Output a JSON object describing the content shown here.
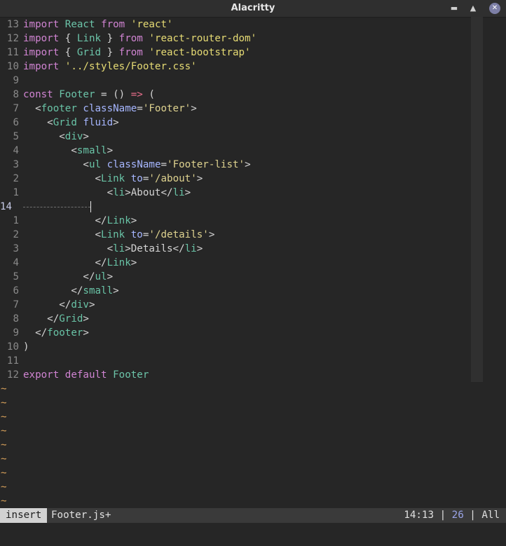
{
  "window": {
    "title": "Alacritty"
  },
  "editor": {
    "lines": [
      {
        "ln": "13",
        "seg": [
          {
            "t": "import",
            "c": "kw"
          },
          {
            "t": " "
          },
          {
            "t": "React",
            "c": "id"
          },
          {
            "t": " "
          },
          {
            "t": "from",
            "c": "kw"
          },
          {
            "t": " "
          },
          {
            "t": "'react'",
            "c": "str"
          }
        ]
      },
      {
        "ln": "12",
        "seg": [
          {
            "t": "import",
            "c": "kw"
          },
          {
            "t": " { "
          },
          {
            "t": "Link",
            "c": "id"
          },
          {
            "t": " } "
          },
          {
            "t": "from",
            "c": "kw"
          },
          {
            "t": " "
          },
          {
            "t": "'react-router-dom'",
            "c": "str"
          }
        ]
      },
      {
        "ln": "11",
        "seg": [
          {
            "t": "import",
            "c": "kw"
          },
          {
            "t": " { "
          },
          {
            "t": "Grid",
            "c": "id"
          },
          {
            "t": " } "
          },
          {
            "t": "from",
            "c": "kw"
          },
          {
            "t": " "
          },
          {
            "t": "'react-bootstrap'",
            "c": "str"
          }
        ]
      },
      {
        "ln": "10",
        "seg": [
          {
            "t": "import",
            "c": "kw"
          },
          {
            "t": " "
          },
          {
            "t": "'../styles/Footer.css'",
            "c": "str"
          }
        ]
      },
      {
        "ln": "9",
        "seg": []
      },
      {
        "ln": "8",
        "seg": [
          {
            "t": "const",
            "c": "kw"
          },
          {
            "t": " "
          },
          {
            "t": "Footer",
            "c": "id"
          },
          {
            "t": " = () "
          },
          {
            "t": "=>",
            "c": "op"
          },
          {
            "t": " ("
          }
        ]
      },
      {
        "ln": "7",
        "seg": [
          {
            "t": "  <"
          },
          {
            "t": "footer",
            "c": "tag"
          },
          {
            "t": " "
          },
          {
            "t": "className",
            "c": "attr"
          },
          {
            "t": "="
          },
          {
            "t": "'Footer'",
            "c": "str2"
          },
          {
            "t": ">"
          }
        ]
      },
      {
        "ln": "6",
        "seg": [
          {
            "t": "    <"
          },
          {
            "t": "Grid",
            "c": "tag"
          },
          {
            "t": " "
          },
          {
            "t": "fluid",
            "c": "attr"
          },
          {
            "t": ">"
          }
        ]
      },
      {
        "ln": "5",
        "seg": [
          {
            "t": "      <"
          },
          {
            "t": "div",
            "c": "tag"
          },
          {
            "t": ">"
          }
        ]
      },
      {
        "ln": "4",
        "seg": [
          {
            "t": "        <"
          },
          {
            "t": "small",
            "c": "tag"
          },
          {
            "t": ">"
          }
        ]
      },
      {
        "ln": "3",
        "seg": [
          {
            "t": "          <"
          },
          {
            "t": "ul",
            "c": "tag"
          },
          {
            "t": " "
          },
          {
            "t": "className",
            "c": "attr"
          },
          {
            "t": "="
          },
          {
            "t": "'Footer-list'",
            "c": "str2"
          },
          {
            "t": ">"
          }
        ]
      },
      {
        "ln": "2",
        "seg": [
          {
            "t": "            <"
          },
          {
            "t": "Link",
            "c": "tag"
          },
          {
            "t": " "
          },
          {
            "t": "to",
            "c": "attr"
          },
          {
            "t": "="
          },
          {
            "t": "'/about'",
            "c": "str2"
          },
          {
            "t": ">"
          }
        ]
      },
      {
        "ln": "1",
        "seg": [
          {
            "t": "              <"
          },
          {
            "t": "li",
            "c": "tag"
          },
          {
            "t": ">About</"
          },
          {
            "t": "li",
            "c": "tag"
          },
          {
            "t": ">"
          }
        ]
      },
      {
        "ln": "14",
        "current": true,
        "seg": []
      },
      {
        "ln": "1",
        "seg": [
          {
            "t": "            </"
          },
          {
            "t": "Link",
            "c": "tag"
          },
          {
            "t": ">"
          }
        ]
      },
      {
        "ln": "2",
        "seg": [
          {
            "t": "            <"
          },
          {
            "t": "Link",
            "c": "tag"
          },
          {
            "t": " "
          },
          {
            "t": "to",
            "c": "attr"
          },
          {
            "t": "="
          },
          {
            "t": "'/details'",
            "c": "str2"
          },
          {
            "t": ">"
          }
        ]
      },
      {
        "ln": "3",
        "seg": [
          {
            "t": "              <"
          },
          {
            "t": "li",
            "c": "tag"
          },
          {
            "t": ">Details</"
          },
          {
            "t": "li",
            "c": "tag"
          },
          {
            "t": ">"
          }
        ]
      },
      {
        "ln": "4",
        "seg": [
          {
            "t": "            </"
          },
          {
            "t": "Link",
            "c": "tag"
          },
          {
            "t": ">"
          }
        ]
      },
      {
        "ln": "5",
        "seg": [
          {
            "t": "          </"
          },
          {
            "t": "ul",
            "c": "tag"
          },
          {
            "t": ">"
          }
        ]
      },
      {
        "ln": "6",
        "seg": [
          {
            "t": "        </"
          },
          {
            "t": "small",
            "c": "tag"
          },
          {
            "t": ">"
          }
        ]
      },
      {
        "ln": "7",
        "seg": [
          {
            "t": "      </"
          },
          {
            "t": "div",
            "c": "tag"
          },
          {
            "t": ">"
          }
        ]
      },
      {
        "ln": "8",
        "seg": [
          {
            "t": "    </"
          },
          {
            "t": "Grid",
            "c": "tag"
          },
          {
            "t": ">"
          }
        ]
      },
      {
        "ln": "9",
        "seg": [
          {
            "t": "  </"
          },
          {
            "t": "footer",
            "c": "tag"
          },
          {
            "t": ">"
          }
        ]
      },
      {
        "ln": "10",
        "seg": [
          {
            "t": ")"
          }
        ]
      },
      {
        "ln": "11",
        "seg": []
      },
      {
        "ln": "12",
        "seg": [
          {
            "t": "export",
            "c": "kw"
          },
          {
            "t": " "
          },
          {
            "t": "default",
            "c": "kw"
          },
          {
            "t": " "
          },
          {
            "t": "Footer",
            "c": "id"
          }
        ]
      }
    ],
    "empty_line_marker": "~",
    "empty_line_count": 9
  },
  "statusbar": {
    "mode": "insert",
    "filename": "Footer.js+",
    "cursor_position": "14:13",
    "separator": " | ",
    "column": "26",
    "scroll": "All"
  },
  "colors": {
    "background": "#262626",
    "keyword": "#d084d2",
    "identifier": "#6cc4a9",
    "string": "#e6db74",
    "tag": "#69c3a6",
    "attribute": "#a6b6ff",
    "arrow": "#e86e8b",
    "tilde": "#d9a25b",
    "close_button": "#7d7fa6"
  }
}
